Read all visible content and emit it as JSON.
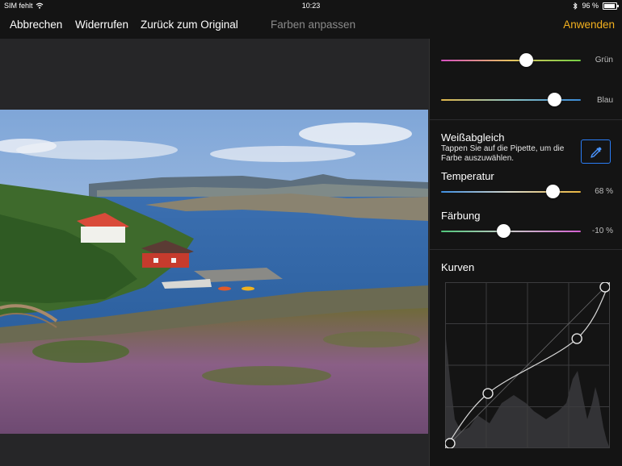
{
  "status_bar": {
    "carrier": "SIM fehlt",
    "time": "10:23",
    "battery_percent": "96 %",
    "battery_level": 0.96,
    "icons": [
      "wifi-icon",
      "bluetooth-icon",
      "battery-icon"
    ]
  },
  "toolbar": {
    "cancel_label": "Abbrechen",
    "undo_label": "Widerrufen",
    "revert_label": "Zurück zum Original",
    "title": "Farben anpassen",
    "apply_label": "Anwenden"
  },
  "panel": {
    "green": {
      "label": "Grün",
      "value": 0.61
    },
    "blue": {
      "label": "Blau",
      "value": 0.81
    },
    "white_balance": {
      "title": "Weißabgleich",
      "hint": "Tappen Sie auf die Pipette, um die Farbe auszuwählen.",
      "icon": "eyedropper-icon"
    },
    "temperature": {
      "title": "Temperatur",
      "value_text": "68 %",
      "value": 0.8
    },
    "tint": {
      "title": "Färbung",
      "value_text": "-10 %",
      "value": 0.45
    },
    "curves": {
      "title": "Kurven",
      "points": [
        [
          0,
          0
        ],
        [
          0.26,
          0.33
        ],
        [
          0.8,
          0.66
        ],
        [
          1,
          1
        ]
      ]
    }
  },
  "colors": {
    "accent": "#f3b11f",
    "selection": "#2a7df5",
    "panel_bg": "#141414",
    "canvas_bg": "#262628"
  }
}
